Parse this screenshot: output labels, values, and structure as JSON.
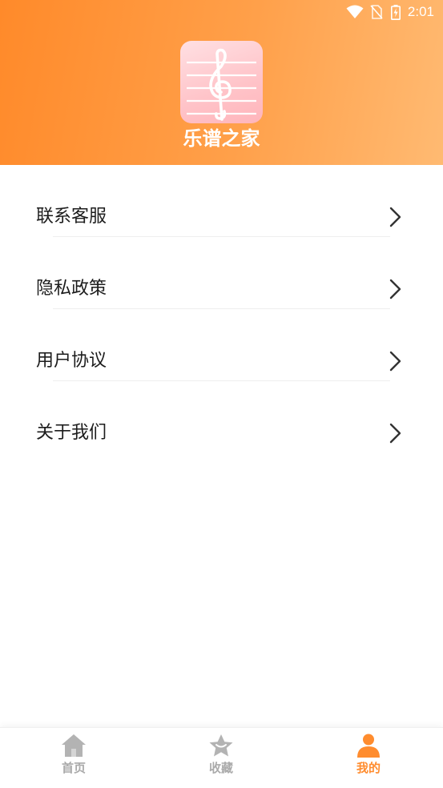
{
  "status_bar": {
    "time": "2:01",
    "icons": [
      "wifi-icon",
      "no-sim-icon",
      "battery-charging-icon"
    ]
  },
  "header": {
    "app_name": "乐谱之家",
    "app_icon": "treble-clef-icon"
  },
  "menu": {
    "items": [
      {
        "label": "联系客服",
        "icon": "chevron-right-icon"
      },
      {
        "label": "隐私政策",
        "icon": "chevron-right-icon"
      },
      {
        "label": "用户协议",
        "icon": "chevron-right-icon"
      },
      {
        "label": "关于我们",
        "icon": "chevron-right-icon"
      }
    ]
  },
  "tabbar": {
    "tabs": [
      {
        "label": "首页",
        "icon": "home-icon",
        "active": false
      },
      {
        "label": "收藏",
        "icon": "star-icon",
        "active": false
      },
      {
        "label": "我的",
        "icon": "user-icon",
        "active": true
      }
    ]
  },
  "colors": {
    "accent": "#ff8c2e",
    "header_start": "#ff8a2a",
    "header_end": "#ffba72",
    "tab_inactive": "#aaaaaa",
    "text": "#1c1c1c"
  }
}
